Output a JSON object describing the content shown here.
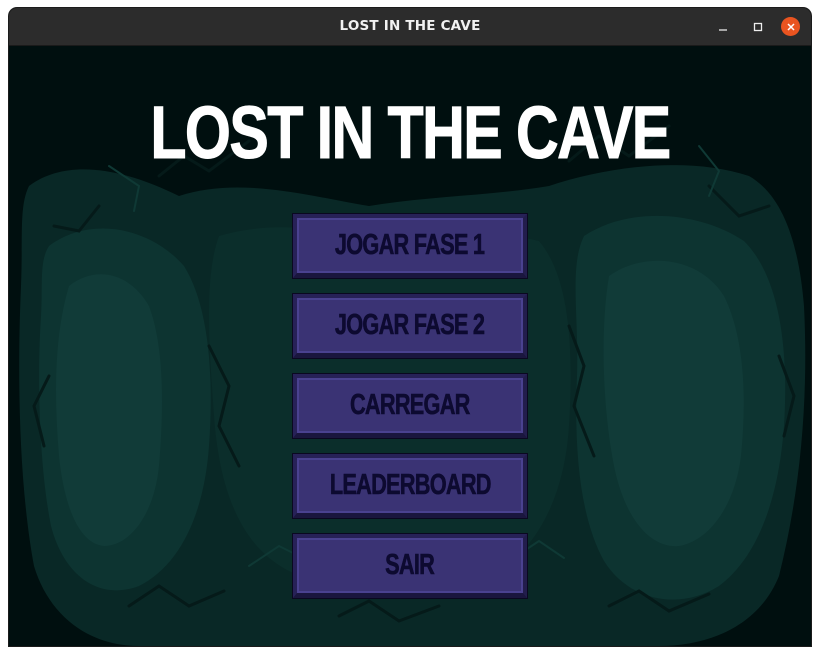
{
  "window": {
    "title": "LOST IN THE CAVE"
  },
  "game": {
    "title": "LOST IN THE CAVE"
  },
  "menu": {
    "items": [
      {
        "label": "JOGAR FASE 1"
      },
      {
        "label": "JOGAR FASE 2"
      },
      {
        "label": "CARREGAR"
      },
      {
        "label": "LEADERBOARD"
      },
      {
        "label": "SAIR"
      }
    ]
  },
  "colors": {
    "background": "#000f0f",
    "cave": "#0d2f2c",
    "button": "#3a3374",
    "button_text": "#0d0a30",
    "title_text": "#ffffff",
    "close_button": "#e95420"
  },
  "icons": {
    "minimize": "minimize-icon",
    "maximize": "maximize-icon",
    "close": "close-icon"
  }
}
